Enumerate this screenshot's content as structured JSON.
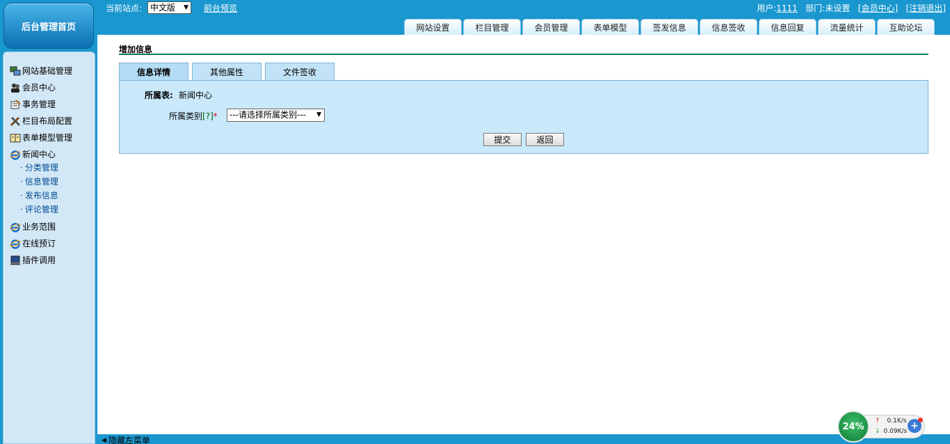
{
  "header": {
    "home_label": "后台管理首页",
    "site_label": "当前站点:",
    "site_select_value": "中文版",
    "preview_link": "前台预览",
    "user_label": "用户:",
    "user_name": "1111",
    "dept_label": "部门:",
    "dept_value": "未设置",
    "member_center_link": "[会员中心]",
    "logout_link": "[注销退出]",
    "tabs": [
      {
        "label": "网站设置"
      },
      {
        "label": "栏目管理"
      },
      {
        "label": "会员管理"
      },
      {
        "label": "表单模型"
      },
      {
        "label": "签发信息"
      },
      {
        "label": "信息签收"
      },
      {
        "label": "信息回复"
      },
      {
        "label": "流量统计"
      },
      {
        "label": "互助论坛"
      }
    ]
  },
  "sidebar": {
    "items": [
      {
        "label": "网站基础管理",
        "icon": "site-admin-icon"
      },
      {
        "label": "会员中心",
        "icon": "members-icon"
      },
      {
        "label": "事务管理",
        "icon": "tasks-icon"
      },
      {
        "label": "栏目布局配置",
        "icon": "tools-icon"
      },
      {
        "label": "表单模型管理",
        "icon": "form-icon"
      },
      {
        "label": "新闻中心",
        "icon": "ie-icon"
      },
      {
        "label": "业务范围",
        "icon": "ie-icon"
      },
      {
        "label": "在线预订",
        "icon": "ie-icon"
      },
      {
        "label": "插件调用",
        "icon": "computer-icon"
      }
    ],
    "news_subitems": [
      {
        "label": "分类管理"
      },
      {
        "label": "信息管理"
      },
      {
        "label": "发布信息"
      },
      {
        "label": "评论管理"
      }
    ],
    "sub_bullet": "·",
    "hide_menu_label": "隐藏左菜单"
  },
  "main": {
    "title": "增加信息",
    "form_tabs": [
      {
        "label": "信息详情"
      },
      {
        "label": "其他属性"
      },
      {
        "label": "文件签收"
      }
    ],
    "table_label": "所属表:",
    "table_value": "新闻中心",
    "category_label": "所属类别",
    "category_help": "[?]",
    "category_required": "*",
    "category_select_value": "---请选择所属类别---",
    "submit_label": "提交",
    "return_label": "返回"
  },
  "net_widget": {
    "percent": "24%",
    "upload": "0.1K/s",
    "download": "0.09K/s",
    "plus": "+"
  },
  "colors": {
    "header_blue": "#1a97cf",
    "sidebar_bg": "#d3e8f7",
    "panel_bg": "#c9e9fb",
    "title_rule": "#107a4a"
  }
}
